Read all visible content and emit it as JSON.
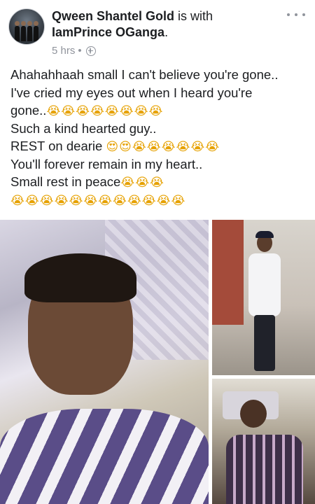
{
  "post": {
    "author_name": "Qween Shantel Gold",
    "with_text": " is with ",
    "tagged_name": "IamPrince OGanga",
    "tagged_suffix": ".",
    "time": "5 hrs",
    "time_sep": "•",
    "privacy_icon": "globe-icon",
    "more_icon": "more-options-icon"
  },
  "text_lines": [
    {
      "text": "Ahahahhaah small I can't believe you're gone..",
      "emoji": ""
    },
    {
      "text": "I've cried my eyes out when I heard you're",
      "emoji": ""
    },
    {
      "text": "gone..",
      "emoji": "😭😭😭😭😭😭😭😭"
    },
    {
      "text": "Such a kind hearted guy..",
      "emoji": ""
    },
    {
      "text": "REST on dearie ",
      "emoji": "😍😍😭😭😭😭😭😭"
    },
    {
      "text": "You'll forever remain in my heart..",
      "emoji": ""
    },
    {
      "text": "Small rest in peace",
      "emoji": "😭😭😭"
    },
    {
      "text": "",
      "emoji": "😭😭😭😭😭😭😭😭😭😭😭😭"
    }
  ],
  "photos": [
    {
      "name": "photo-selfie"
    },
    {
      "name": "photo-standing"
    },
    {
      "name": "photo-lying"
    }
  ]
}
